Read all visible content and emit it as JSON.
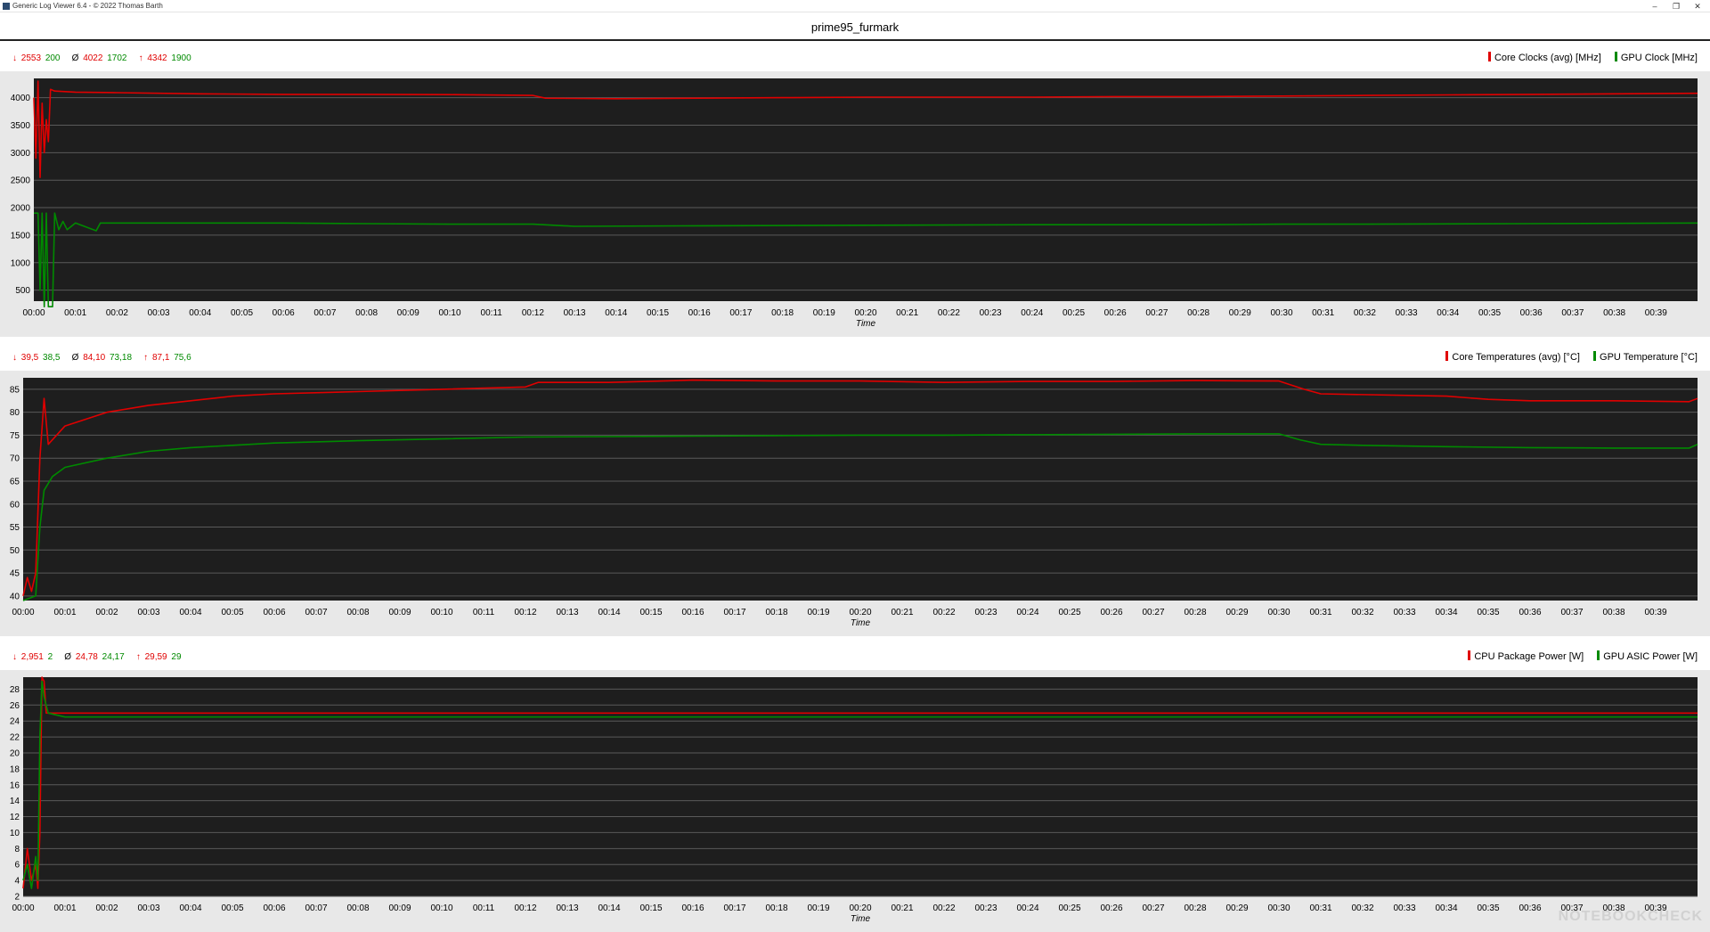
{
  "window": {
    "title": "Generic Log Viewer 6.4 - © 2022 Thomas Barth"
  },
  "window_controls": {
    "minimize": "–",
    "restore": "❐",
    "close": "✕"
  },
  "document": {
    "title": "prime95_furmark"
  },
  "watermark": "NOTEBOOKCHECK",
  "colors": {
    "series1": "#e00000",
    "series2": "#008a00",
    "plot_bg": "#1e1e1e",
    "grid": "#5a5a5a"
  },
  "panels": [
    {
      "stats": {
        "min_sym": "↓",
        "min_a": "2553",
        "min_b": "200",
        "avg_sym": "Ø",
        "avg_a": "4022",
        "avg_b": "1702",
        "max_sym": "↑",
        "max_a": "4342",
        "max_b": "1900"
      },
      "legend": [
        "Core Clocks (avg) [MHz]",
        "GPU Clock [MHz]"
      ]
    },
    {
      "stats": {
        "min_sym": "↓",
        "min_a": "39,5",
        "min_b": "38,5",
        "avg_sym": "Ø",
        "avg_a": "84,10",
        "avg_b": "73,18",
        "max_sym": "↑",
        "max_a": "87,1",
        "max_b": "75,6"
      },
      "legend": [
        "Core Temperatures (avg) [°C]",
        "GPU Temperature [°C]"
      ]
    },
    {
      "stats": {
        "min_sym": "↓",
        "min_a": "2,951",
        "min_b": "2",
        "avg_sym": "Ø",
        "avg_a": "24,78",
        "avg_b": "24,17",
        "max_sym": "↑",
        "max_a": "29,59",
        "max_b": "29"
      },
      "legend": [
        "CPU Package Power [W]",
        "GPU ASIC Power [W]"
      ]
    }
  ],
  "chart_data": [
    {
      "type": "line",
      "xlabel": "Time",
      "x_ticks": [
        "00:00",
        "00:01",
        "00:02",
        "00:03",
        "00:04",
        "00:05",
        "00:06",
        "00:07",
        "00:08",
        "00:09",
        "00:10",
        "00:11",
        "00:12",
        "00:13",
        "00:14",
        "00:15",
        "00:16",
        "00:17",
        "00:18",
        "00:19",
        "00:20",
        "00:21",
        "00:22",
        "00:23",
        "00:24",
        "00:25",
        "00:26",
        "00:27",
        "00:28",
        "00:29",
        "00:30",
        "00:31",
        "00:32",
        "00:33",
        "00:34",
        "00:35",
        "00:36",
        "00:37",
        "00:38",
        "00:39"
      ],
      "xlim": [
        0,
        40
      ],
      "ylim": [
        300,
        4350
      ],
      "y_ticks": [
        500,
        1000,
        1500,
        2000,
        2500,
        3000,
        3500,
        4000
      ],
      "grid": true,
      "legend_position": "top-right",
      "series": [
        {
          "name": "Core Clocks (avg) [MHz]",
          "color": "#e00000",
          "points": [
            [
              0,
              4000
            ],
            [
              0.05,
              2900
            ],
            [
              0.1,
              4300
            ],
            [
              0.15,
              2550
            ],
            [
              0.2,
              3900
            ],
            [
              0.25,
              3000
            ],
            [
              0.3,
              3600
            ],
            [
              0.35,
              3200
            ],
            [
              0.4,
              4150
            ],
            [
              0.5,
              4120
            ],
            [
              1,
              4100
            ],
            [
              2,
              4090
            ],
            [
              4,
              4070
            ],
            [
              6,
              4060
            ],
            [
              8,
              4060
            ],
            [
              10,
              4055
            ],
            [
              12,
              4040
            ],
            [
              12.3,
              3990
            ],
            [
              14,
              3980
            ],
            [
              16,
              3990
            ],
            [
              18,
              4000
            ],
            [
              20,
              4010
            ],
            [
              22,
              4010
            ],
            [
              24,
              4010
            ],
            [
              26,
              4020
            ],
            [
              28,
              4020
            ],
            [
              30,
              4030
            ],
            [
              32,
              4040
            ],
            [
              34,
              4050
            ],
            [
              36,
              4060
            ],
            [
              38,
              4070
            ],
            [
              40,
              4080
            ]
          ]
        },
        {
          "name": "GPU Clock [MHz]",
          "color": "#008a00",
          "points": [
            [
              0,
              1900
            ],
            [
              0.1,
              1900
            ],
            [
              0.15,
              500
            ],
            [
              0.2,
              1900
            ],
            [
              0.25,
              200
            ],
            [
              0.3,
              1900
            ],
            [
              0.35,
              200
            ],
            [
              0.45,
              200
            ],
            [
              0.5,
              1900
            ],
            [
              0.6,
              1600
            ],
            [
              0.7,
              1750
            ],
            [
              0.8,
              1600
            ],
            [
              1,
              1720
            ],
            [
              1.5,
              1580
            ],
            [
              1.6,
              1720
            ],
            [
              2,
              1720
            ],
            [
              4,
              1720
            ],
            [
              6,
              1720
            ],
            [
              8,
              1710
            ],
            [
              10,
              1700
            ],
            [
              12,
              1700
            ],
            [
              13,
              1660
            ],
            [
              16,
              1670
            ],
            [
              20,
              1680
            ],
            [
              24,
              1690
            ],
            [
              28,
              1690
            ],
            [
              30,
              1700
            ],
            [
              32,
              1700
            ],
            [
              36,
              1710
            ],
            [
              40,
              1720
            ]
          ]
        }
      ]
    },
    {
      "type": "line",
      "xlabel": "Time",
      "x_ticks": [
        "00:00",
        "00:01",
        "00:02",
        "00:03",
        "00:04",
        "00:05",
        "00:06",
        "00:07",
        "00:08",
        "00:09",
        "00:10",
        "00:11",
        "00:12",
        "00:13",
        "00:14",
        "00:15",
        "00:16",
        "00:17",
        "00:18",
        "00:19",
        "00:20",
        "00:21",
        "00:22",
        "00:23",
        "00:24",
        "00:25",
        "00:26",
        "00:27",
        "00:28",
        "00:29",
        "00:30",
        "00:31",
        "00:32",
        "00:33",
        "00:34",
        "00:35",
        "00:36",
        "00:37",
        "00:38",
        "00:39"
      ],
      "xlim": [
        0,
        40
      ],
      "ylim": [
        39,
        87.5
      ],
      "y_ticks": [
        40,
        45,
        50,
        55,
        60,
        65,
        70,
        75,
        80,
        85
      ],
      "grid": true,
      "legend_position": "top-right",
      "series": [
        {
          "name": "Core Temperatures (avg) [°C]",
          "color": "#e00000",
          "points": [
            [
              0,
              40
            ],
            [
              0.1,
              44
            ],
            [
              0.2,
              41
            ],
            [
              0.3,
              45
            ],
            [
              0.4,
              70
            ],
            [
              0.5,
              83
            ],
            [
              0.6,
              73
            ],
            [
              1,
              77
            ],
            [
              2,
              80
            ],
            [
              3,
              81.5
            ],
            [
              4,
              82.5
            ],
            [
              5,
              83.5
            ],
            [
              6,
              84
            ],
            [
              8,
              84.5
            ],
            [
              10,
              85
            ],
            [
              12,
              85.5
            ],
            [
              12.3,
              86.5
            ],
            [
              14,
              86.5
            ],
            [
              16,
              87
            ],
            [
              18,
              86.8
            ],
            [
              20,
              86.8
            ],
            [
              22,
              86.5
            ],
            [
              24,
              86.7
            ],
            [
              26,
              86.7
            ],
            [
              28,
              86.9
            ],
            [
              30,
              86.8
            ],
            [
              30.6,
              85
            ],
            [
              31,
              84
            ],
            [
              34,
              83.5
            ],
            [
              35,
              82.8
            ],
            [
              36,
              82.5
            ],
            [
              38,
              82.5
            ],
            [
              39.8,
              82.3
            ],
            [
              40,
              83
            ]
          ]
        },
        {
          "name": "GPU Temperature [°C]",
          "color": "#008a00",
          "points": [
            [
              0,
              39
            ],
            [
              0.3,
              40
            ],
            [
              0.4,
              55
            ],
            [
              0.5,
              63
            ],
            [
              0.7,
              66
            ],
            [
              1,
              68
            ],
            [
              2,
              70
            ],
            [
              3,
              71.5
            ],
            [
              4,
              72.3
            ],
            [
              5,
              72.8
            ],
            [
              6,
              73.3
            ],
            [
              8,
              73.8
            ],
            [
              10,
              74.2
            ],
            [
              12,
              74.6
            ],
            [
              14,
              74.7
            ],
            [
              16,
              74.8
            ],
            [
              18,
              74.9
            ],
            [
              20,
              75
            ],
            [
              22,
              75
            ],
            [
              24,
              75.1
            ],
            [
              26,
              75.2
            ],
            [
              28,
              75.3
            ],
            [
              30,
              75.3
            ],
            [
              30.5,
              74
            ],
            [
              31,
              73
            ],
            [
              32,
              72.8
            ],
            [
              34,
              72.5
            ],
            [
              36,
              72.3
            ],
            [
              38,
              72.2
            ],
            [
              39.8,
              72.2
            ],
            [
              40,
              73
            ]
          ]
        }
      ]
    },
    {
      "type": "line",
      "xlabel": "Time",
      "x_ticks": [
        "00:00",
        "00:01",
        "00:02",
        "00:03",
        "00:04",
        "00:05",
        "00:06",
        "00:07",
        "00:08",
        "00:09",
        "00:10",
        "00:11",
        "00:12",
        "00:13",
        "00:14",
        "00:15",
        "00:16",
        "00:17",
        "00:18",
        "00:19",
        "00:20",
        "00:21",
        "00:22",
        "00:23",
        "00:24",
        "00:25",
        "00:26",
        "00:27",
        "00:28",
        "00:29",
        "00:30",
        "00:31",
        "00:32",
        "00:33",
        "00:34",
        "00:35",
        "00:36",
        "00:37",
        "00:38",
        "00:39"
      ],
      "xlim": [
        0,
        40
      ],
      "ylim": [
        2,
        29.5
      ],
      "y_ticks": [
        2,
        4,
        6,
        8,
        10,
        12,
        14,
        16,
        18,
        20,
        22,
        24,
        26,
        28
      ],
      "grid": true,
      "legend_position": "top-right",
      "series": [
        {
          "name": "CPU Package Power [W]",
          "color": "#e00000",
          "points": [
            [
              0,
              3
            ],
            [
              0.1,
              8
            ],
            [
              0.2,
              4
            ],
            [
              0.3,
              6
            ],
            [
              0.35,
              3
            ],
            [
              0.4,
              10
            ],
            [
              0.45,
              29.5
            ],
            [
              0.5,
              29
            ],
            [
              0.55,
              25
            ],
            [
              0.6,
              25
            ],
            [
              1,
              25
            ],
            [
              5,
              25
            ],
            [
              10,
              25
            ],
            [
              15,
              25
            ],
            [
              20,
              25
            ],
            [
              25,
              25
            ],
            [
              30,
              25
            ],
            [
              35,
              25
            ],
            [
              40,
              25
            ]
          ]
        },
        {
          "name": "GPU ASIC Power [W]",
          "color": "#008a00",
          "points": [
            [
              0,
              4
            ],
            [
              0.1,
              6
            ],
            [
              0.2,
              3
            ],
            [
              0.3,
              7
            ],
            [
              0.35,
              4
            ],
            [
              0.4,
              22
            ],
            [
              0.45,
              29
            ],
            [
              0.5,
              27
            ],
            [
              0.6,
              25
            ],
            [
              1,
              24.5
            ],
            [
              5,
              24.5
            ],
            [
              10,
              24.5
            ],
            [
              15,
              24.5
            ],
            [
              20,
              24.5
            ],
            [
              25,
              24.5
            ],
            [
              30,
              24.5
            ],
            [
              35,
              24.5
            ],
            [
              40,
              24.5
            ]
          ]
        }
      ]
    }
  ]
}
